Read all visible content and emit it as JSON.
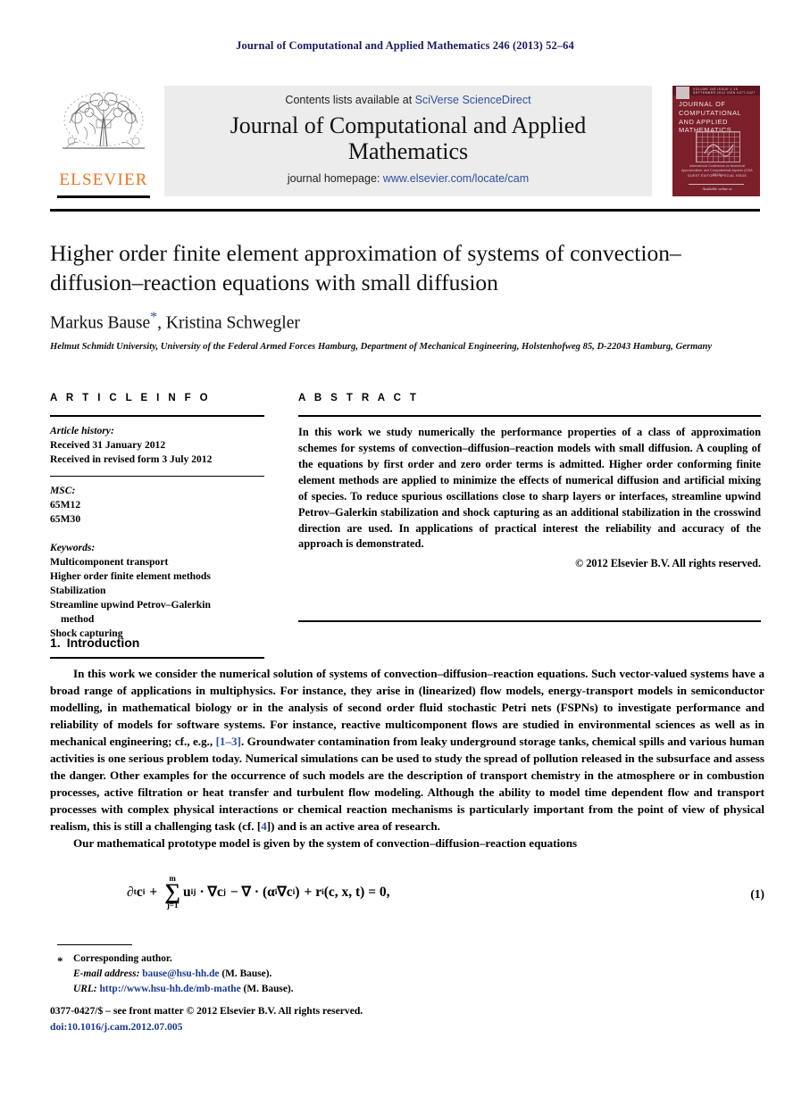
{
  "running_head": "Journal of Computational and Applied Mathematics 246 (2013) 52–64",
  "masthead": {
    "contents_prefix": "Contents lists available at ",
    "contents_link": "SciVerse ScienceDirect",
    "journal_title": "Journal of Computational and Applied Mathematics",
    "homepage_prefix": "journal homepage: ",
    "homepage_url": "www.elsevier.com/locate/cam",
    "publisher_wordmark": "ELSEVIER",
    "publisher_color": "#E87722",
    "cover": {
      "background_color": "#7b1f2b",
      "title": "JOURNAL OF COMPUTATIONAL AND APPLIED MATHEMATICS",
      "topbar_text": "VOLUME 246      ISSUE 1      15 SEPTEMBER 2012      ISSN 0377-0427",
      "caption": "International Conference on Numerical Approximation: and Computational Aspects (ICNA 2012)",
      "caption2": "GUEST EDITORS: SPECIAL ISSUE",
      "footer": "Available online at"
    }
  },
  "article": {
    "title": "Higher order finite element approximation of systems of convection–diffusion–reaction equations with small diffusion",
    "authors": "Markus Bause",
    "author_marker": "*",
    "authors_rest": ", Kristina Schwegler",
    "affiliation": "Helmut Schmidt University, University of the Federal Armed Forces Hamburg, Department of Mechanical Engineering, Holstenhofweg 85, D-22043 Hamburg, Germany"
  },
  "info": {
    "heading": "A R T I C L E    I N F O",
    "history_label": "Article history:",
    "history": [
      "Received 31 January 2012",
      "Received in revised form 3 July 2012"
    ],
    "msc_label": "MSC:",
    "msc": [
      "65M12",
      "65M30"
    ],
    "keywords_label": "Keywords:",
    "keywords": [
      "Multicomponent transport",
      "Higher order finite element methods",
      "Stabilization",
      "Streamline upwind Petrov–Galerkin",
      "method",
      "Shock capturing"
    ]
  },
  "abstract": {
    "heading": "A B S T R A C T",
    "text": "In this work we study numerically the performance properties of a class of approximation schemes for systems of convection–diffusion–reaction models with small diffusion. A coupling of the equations by first order and zero order terms is admitted. Higher order conforming finite element methods are applied to minimize the effects of numerical diffusion and artificial mixing of species. To reduce spurious oscillations close to sharp layers or interfaces, streamline upwind Petrov–Galerkin stabilization and shock capturing as an additional stabilization in the crosswind direction are used. In applications of practical interest the reliability and accuracy of the approach is demonstrated.",
    "copyright": "© 2012 Elsevier B.V. All rights reserved."
  },
  "body": {
    "section_number": "1.",
    "section_title": "Introduction",
    "paragraph1_a": "In this work we consider the numerical solution of systems of convection–diffusion–reaction equations. Such vector-valued systems have a broad range of applications in multiphysics. For instance, they arise in (linearized) flow models, energy-transport models in semiconductor modelling, in mathematical biology or in the analysis of second order fluid stochastic Petri nets (FSPNs) to investigate performance and reliability of models for software systems. For instance, reactive multicomponent flows are studied in environmental sciences as well as in mechanical engineering; cf., e.g., ",
    "citation1": "[1–3]",
    "paragraph1_b": ". Groundwater contamination from leaky underground storage tanks, chemical spills and various human activities is one serious problem today. Numerical simulations can be used to study the spread of pollution released in the subsurface and assess the danger. Other examples for the occurrence of such models are the description of transport chemistry in the atmosphere or in combustion processes, active filtration or heat transfer and turbulent flow modeling. Although the ability to model time dependent flow and transport processes with complex physical interactions or chemical reaction mechanisms is particularly important from the point of view of physical realism, this is still a challenging task (cf. [",
    "citation2": "4",
    "paragraph1_c": "]) and is an active area of research.",
    "paragraph2": "Our mathematical prototype model is given by the system of convection–diffusion–reaction equations"
  },
  "equation": {
    "number": "(1)",
    "lhs_dt": "∂",
    "lhs_dt_sub": "t",
    "lhs_c": "c",
    "lhs_c_sub": "i",
    "plus": "+",
    "sum_upper": "m",
    "sum_symbol": "∑",
    "sum_lower": "j=1",
    "u_term": "u",
    "u_sub": "ij",
    "dot_grad_c": "· ∇c",
    "cj_sub": "j",
    "minus_div": "− ∇ · (",
    "alpha": "α",
    "alpha_sub": "i",
    "grad_c": "∇c",
    "grad_c_sub": "i",
    "close_paren": ")",
    "plus2": "+ r",
    "r_sub": "i",
    "args": "(c, x, t) = 0,"
  },
  "footnote": {
    "marker": "*",
    "corresponding": "Corresponding author.",
    "email_label": "E-mail address:",
    "email": "bause@hsu-hh.de",
    "email_attrib": "(M. Bause).",
    "url_label": "URL:",
    "url": "http://www.hsu-hh.de/mb-mathe",
    "url_attrib": "(M. Bause)."
  },
  "bottom": {
    "front_matter": "0377-0427/$ – see front matter © 2012 Elsevier B.V. All rights reserved.",
    "doi": "doi:10.1016/j.cam.2012.07.005"
  }
}
